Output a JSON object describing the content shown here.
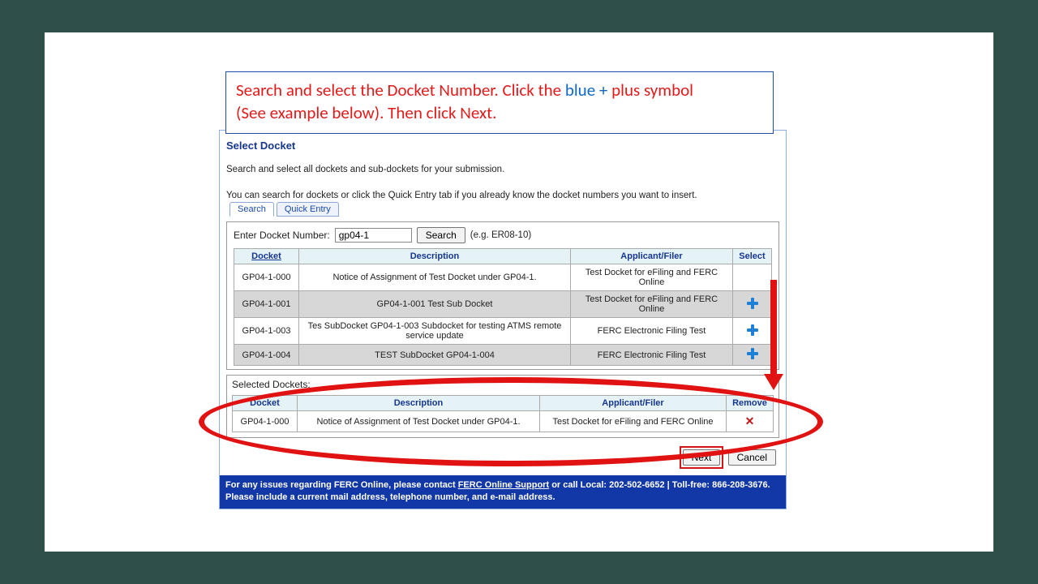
{
  "instruction": {
    "line1_prefix": "Search and select the Docket Number.  Click the ",
    "line1_blue": "blue + ",
    "line1_suffix": "plus symbol",
    "line2": "(See example below). Then click Next."
  },
  "panel": {
    "title": "Select Docket",
    "intro": "Search and select all dockets and sub-dockets for your submission.",
    "sub": "You can search for dockets or click the Quick Entry tab if you already know the docket numbers you want to insert."
  },
  "tabs": {
    "search": "Search",
    "quick_entry": "Quick Entry"
  },
  "search": {
    "label": "Enter Docket Number:",
    "value": "gp04-1",
    "button": "Search",
    "hint": "(e.g. ER08-10)"
  },
  "results_headers": {
    "docket": "Docket",
    "description": "Description",
    "applicant": "Applicant/Filer",
    "select": "Select"
  },
  "results": [
    {
      "docket": "GP04-1-000",
      "description": "Notice of Assignment of Test Docket under GP04-1.",
      "applicant": "Test Docket for eFiling and FERC Online",
      "has_plus": false,
      "alt": false
    },
    {
      "docket": "GP04-1-001",
      "description": "GP04-1-001 Test Sub Docket",
      "applicant": "Test Docket for eFiling and FERC Online",
      "has_plus": true,
      "alt": true
    },
    {
      "docket": "GP04-1-003",
      "description": "Tes SubDocket GP04-1-003 Subdocket for testing ATMS remote service update",
      "applicant": "FERC Electronic Filing Test",
      "has_plus": true,
      "alt": false
    },
    {
      "docket": "GP04-1-004",
      "description": "TEST SubDocket GP04-1-004",
      "applicant": "FERC Electronic Filing Test",
      "has_plus": true,
      "alt": true
    }
  ],
  "selected": {
    "title": "Selected Dockets:",
    "headers": {
      "docket": "Docket",
      "description": "Description",
      "applicant": "Applicant/Filer",
      "remove": "Remove"
    },
    "rows": [
      {
        "docket": "GP04-1-000",
        "description": "Notice of Assignment of Test Docket under GP04-1.",
        "applicant": "Test Docket for eFiling and FERC Online"
      }
    ]
  },
  "actions": {
    "next": "Next",
    "cancel": "Cancel"
  },
  "footer": {
    "pre": "For any issues regarding FERC Online, please contact ",
    "link": "FERC Online Support",
    "mid": " or call Local: 202-502-6652 | Toll-free: 866-208-3676. Please include a current mail address, telephone number, and e-mail address."
  }
}
